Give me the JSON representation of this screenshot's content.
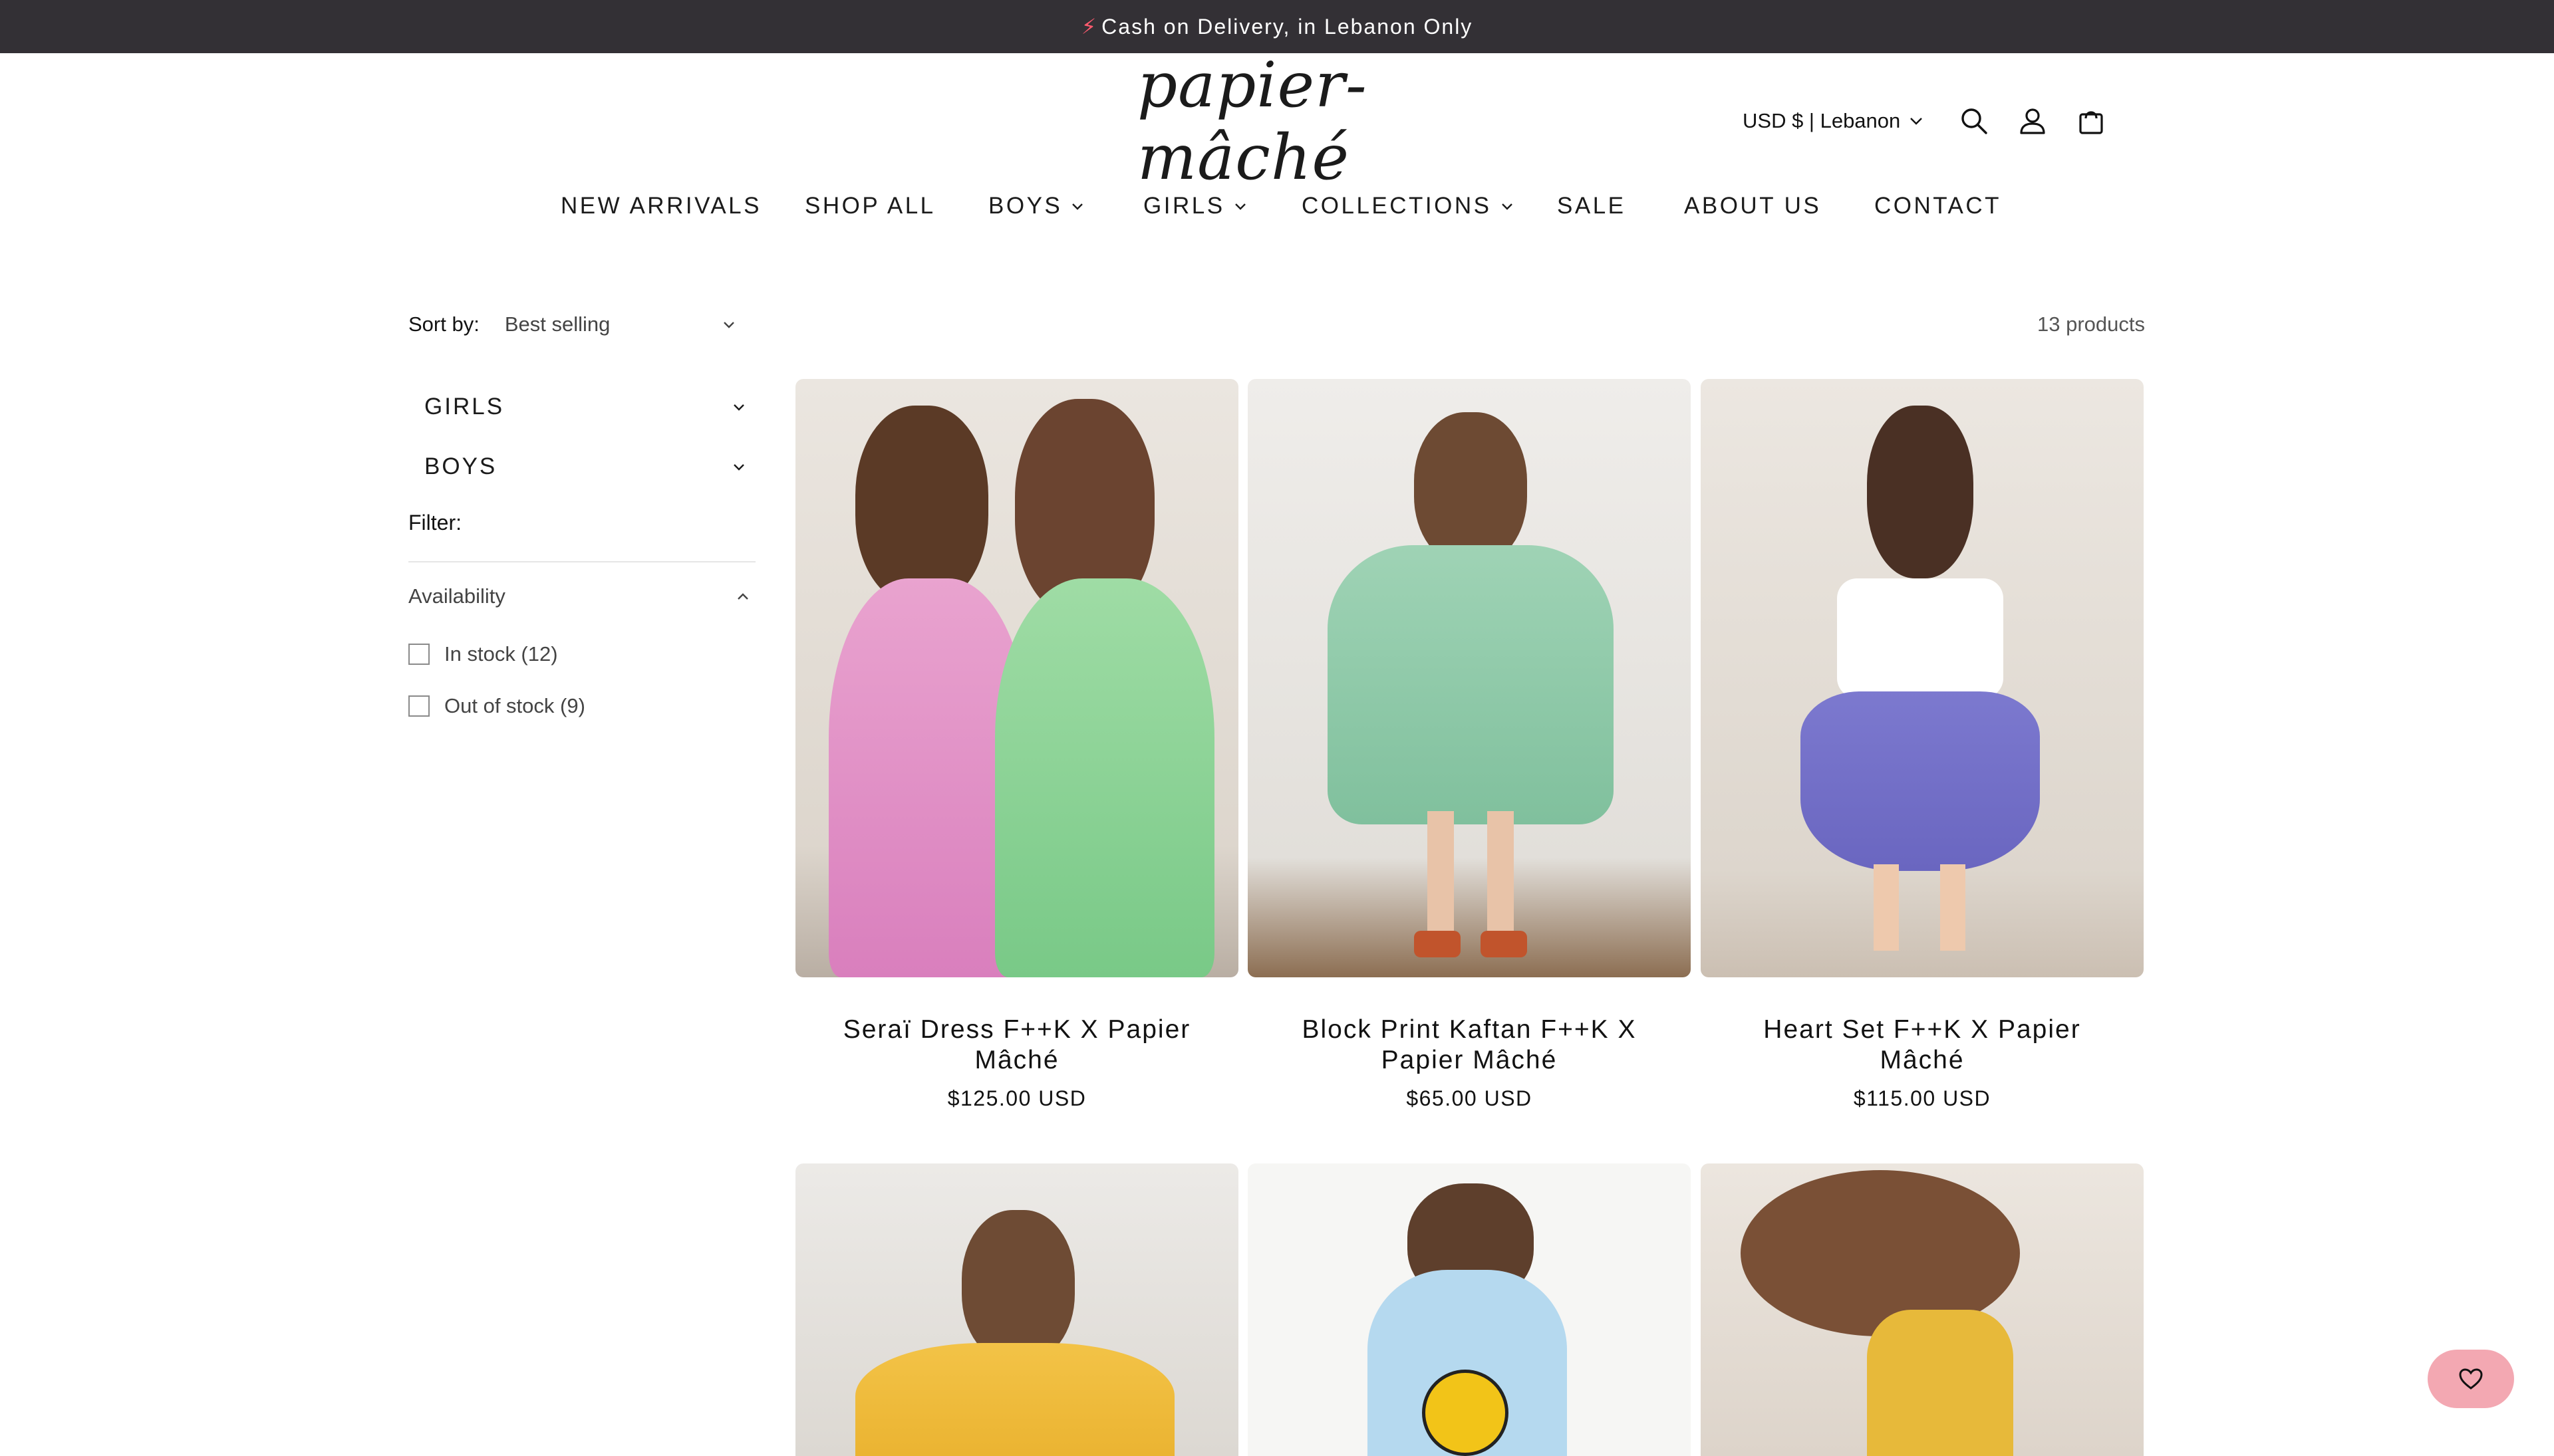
{
  "announcement": {
    "icon": "lightning-icon",
    "text": "Cash on Delivery, in Lebanon Only"
  },
  "header": {
    "logo_text": "papier-mâché",
    "locale": "USD $ | Lebanon",
    "icons": [
      "search-icon",
      "account-icon",
      "cart-icon"
    ]
  },
  "nav": {
    "items": [
      {
        "label": "NEW ARRIVALS",
        "has_dropdown": false
      },
      {
        "label": "SHOP ALL",
        "has_dropdown": false
      },
      {
        "label": "BOYS",
        "has_dropdown": true
      },
      {
        "label": "GIRLS",
        "has_dropdown": true
      },
      {
        "label": "COLLECTIONS",
        "has_dropdown": true
      },
      {
        "label": "SALE",
        "has_dropdown": false
      },
      {
        "label": "ABOUT US",
        "has_dropdown": false
      },
      {
        "label": "CONTACT",
        "has_dropdown": false
      }
    ]
  },
  "toolbar": {
    "sort_label": "Sort by:",
    "sort_value": "Best selling",
    "product_count": "13 products"
  },
  "sidebar": {
    "categories": [
      {
        "label": "GIRLS"
      },
      {
        "label": "BOYS"
      }
    ],
    "filter_label": "Filter:",
    "availability_label": "Availability",
    "options": [
      {
        "label": "In stock (12)",
        "checked": false
      },
      {
        "label": "Out of stock (9)",
        "checked": false
      }
    ]
  },
  "products": [
    {
      "title": "Seraï Dress F++K X Papier Mâché",
      "price": "$125.00 USD"
    },
    {
      "title": "Block Print Kaftan F++K X Papier Mâché",
      "price": "$65.00 USD"
    },
    {
      "title": "Heart Set F++K X Papier Mâché",
      "price": "$115.00 USD"
    }
  ],
  "colors": {
    "announcement_bg": "#333035",
    "wishlist_button": "#f3a8b2",
    "text": "#121212"
  },
  "wishlist": {
    "icon": "heart-icon"
  }
}
